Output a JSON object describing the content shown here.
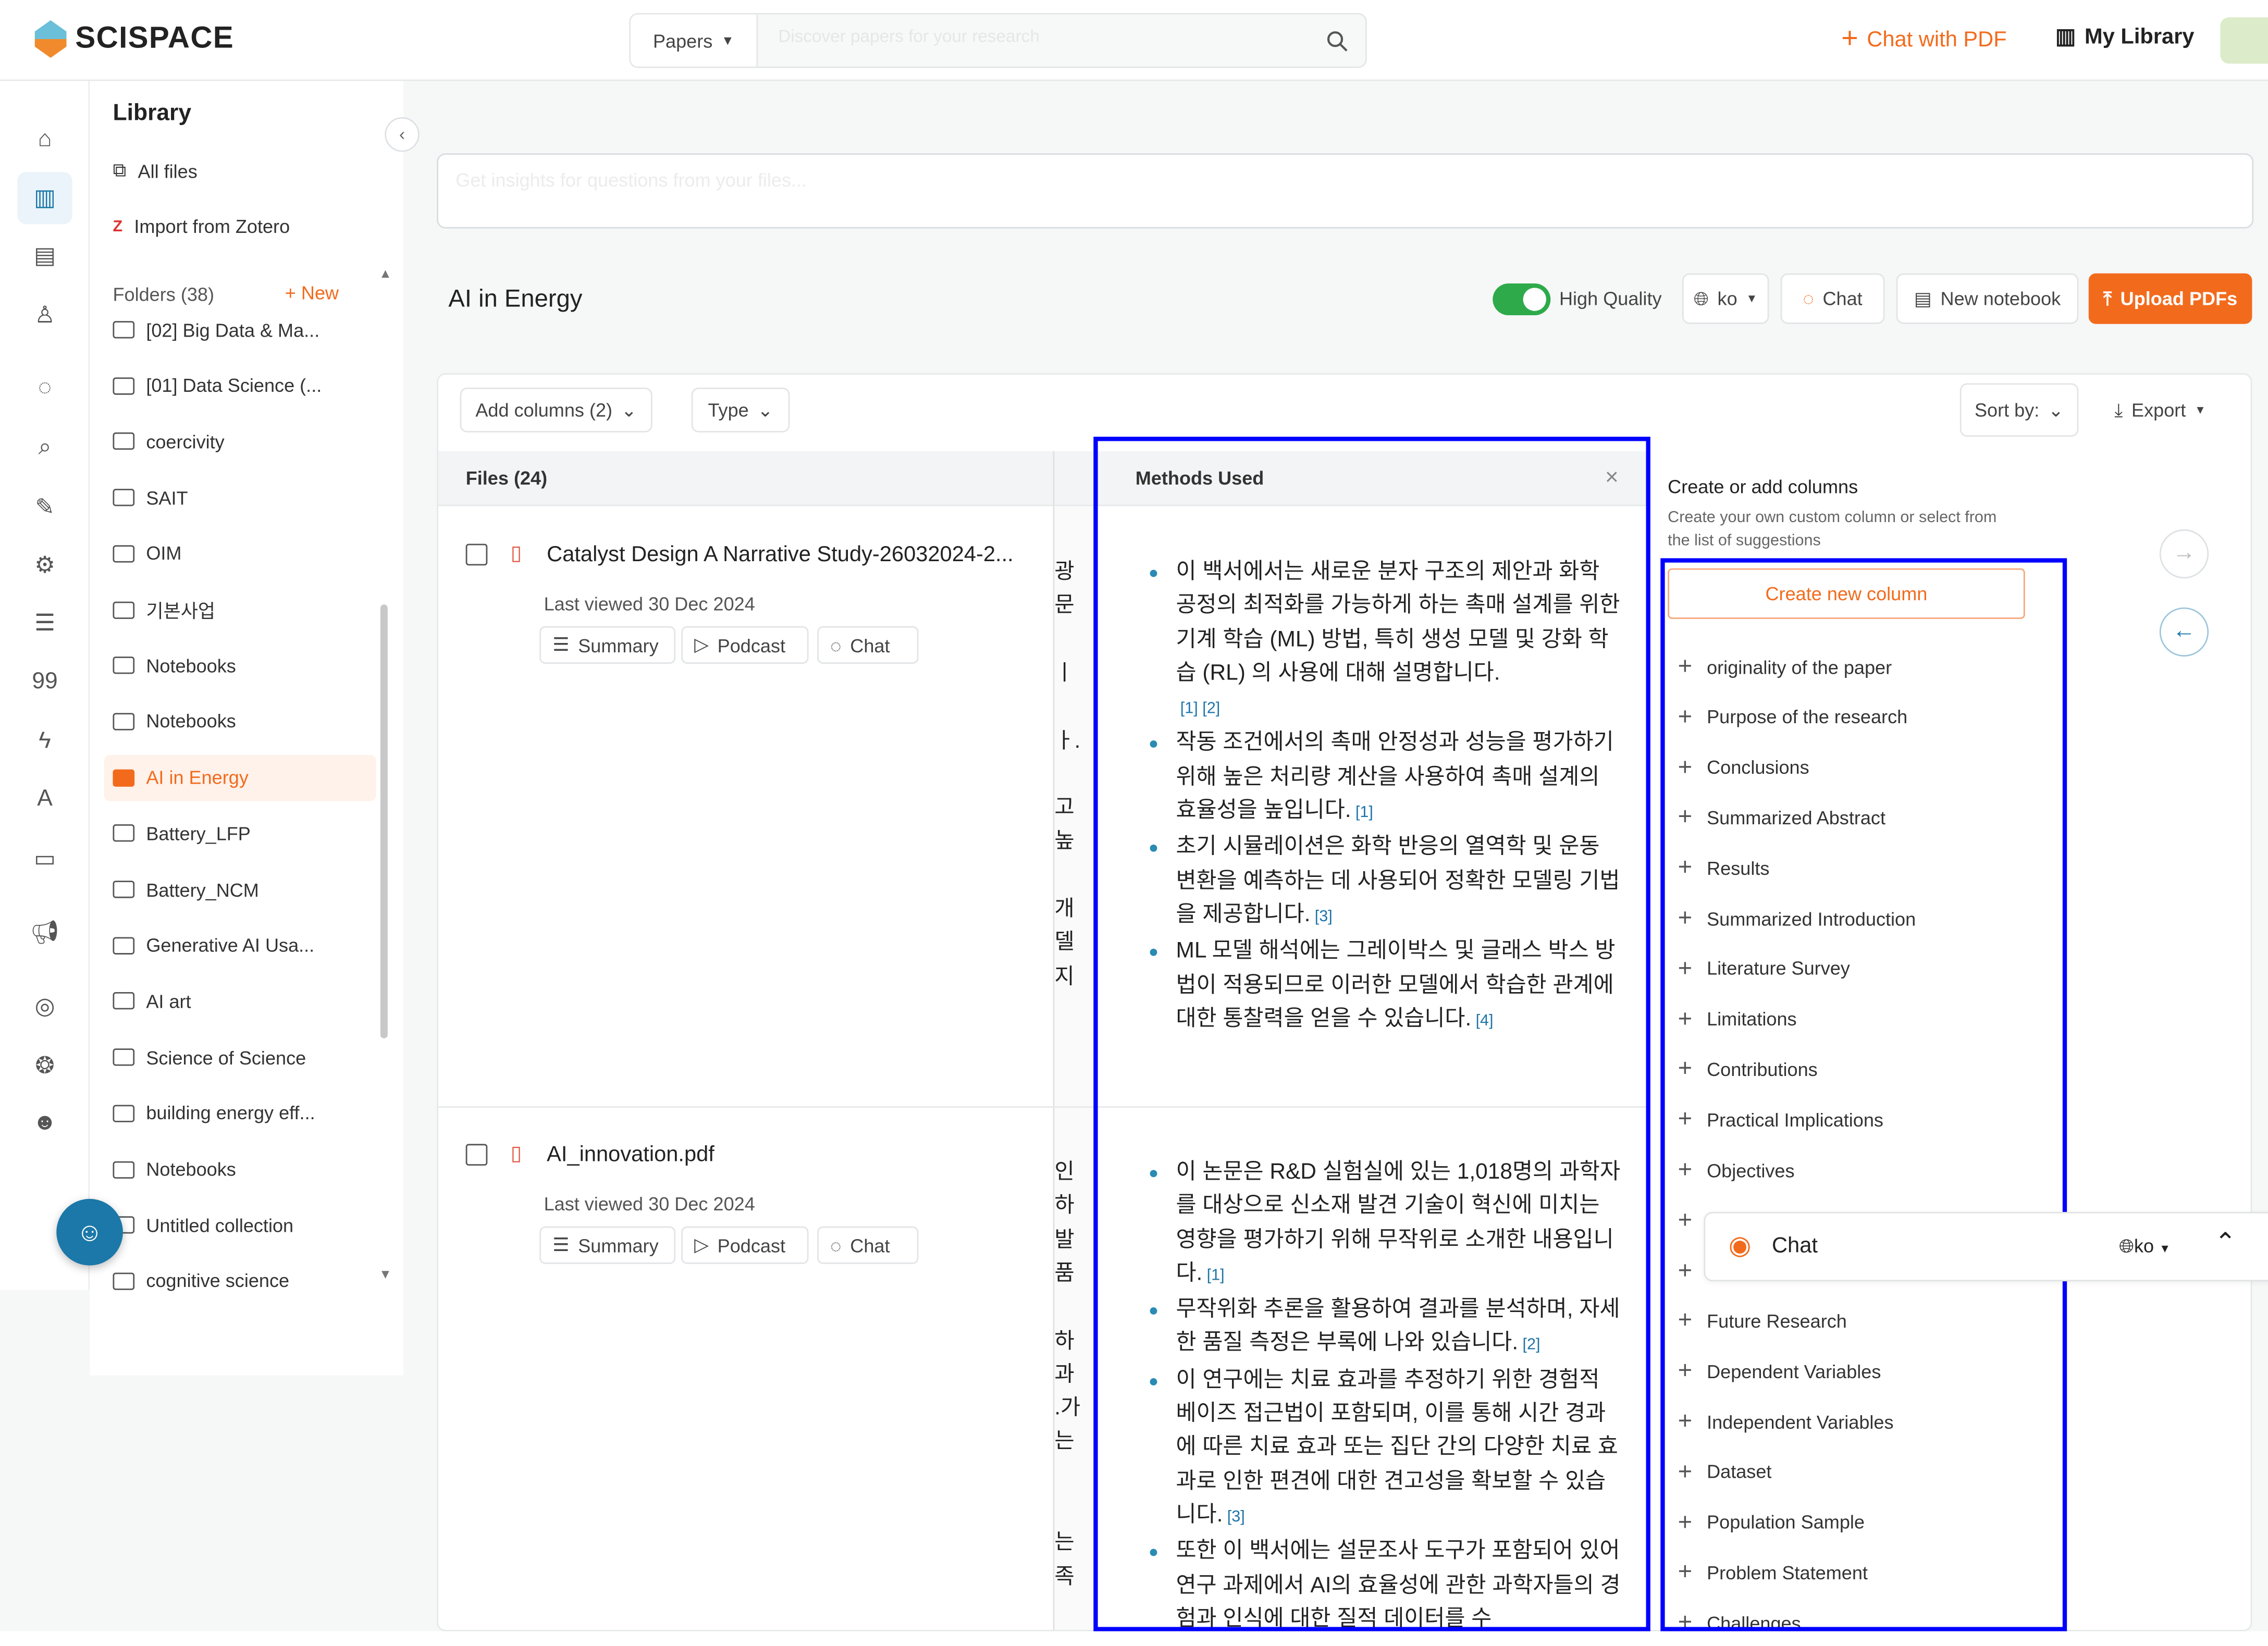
{
  "header": {
    "brand": "SCISPACE",
    "search_scope": "Papers",
    "search_placeholder": "Discover papers for your research",
    "chat_with_pdf": "Chat with PDF",
    "my_library": "My Library"
  },
  "rail": {
    "icons": [
      "home-icon",
      "library-icon",
      "notebook-icon",
      "user-icon",
      "chat-icon",
      "search-icon",
      "pen-icon",
      "integrations-icon",
      "list-icon",
      "quote-icon",
      "bolt-icon",
      "ai-icon",
      "video-icon",
      "megaphone-icon",
      "chrome-icon",
      "openai-icon",
      "discord-icon"
    ]
  },
  "library": {
    "title": "Library",
    "all_files": "All files",
    "import_zotero": "Import from Zotero",
    "folders_label": "Folders (38)",
    "new_label": "New",
    "folders": [
      "[02] Big Data & Ma...",
      "[01] Data Science (...",
      "coercivity",
      "SAIT",
      "OIM",
      "기본사업",
      "Notebooks",
      "Notebooks",
      "AI in Energy",
      "Battery_LFP",
      "Battery_NCM",
      "Generative AI Usa...",
      "AI art",
      "Science of Science",
      "building energy eff...",
      "Notebooks",
      "Untitled collection",
      "cognitive science"
    ],
    "active_folder": "AI in Energy"
  },
  "main": {
    "insights_placeholder": "Get insights for questions from your files...",
    "title": "AI in Energy",
    "high_quality": "High Quality",
    "high_quality_on": true,
    "language": "ko",
    "chat": "Chat",
    "new_notebook": "New notebook",
    "upload": "Upload PDFs"
  },
  "table": {
    "add_columns": "Add columns (2)",
    "type": "Type",
    "sort_by": "Sort by:",
    "export": "Export",
    "files_header": "Files (24)",
    "methods_header": "Methods Used",
    "rows": [
      {
        "name": "Catalyst Design A Narrative Study-26032024-2...",
        "last_viewed": "Last viewed 30 Dec 2024",
        "actions": [
          "Summary",
          "Podcast",
          "Chat"
        ],
        "hidden_col": [
          "광",
          "문",
          "",
          "ㅣ",
          "",
          "ㅏ.",
          "",
          "고",
          "높",
          "",
          "개",
          "델",
          "지"
        ],
        "methods": [
          {
            "text": "이 백서에서는 새로운 분자 구조의 제안과 화학 공정의 최적화를 가능하게 하는 촉매 설계를 위한 기계 학습 (ML) 방법, 특히 생성 모델 및 강화 학습 (RL) 의 사용에 대해 설명합니다.",
            "cite": "[1] [2]"
          },
          {
            "text": "작동 조건에서의 촉매 안정성과 성능을 평가하기 위해 높은 처리량 계산을 사용하여 촉매 설계의 효율성을 높입니다.",
            "cite": "[1]"
          },
          {
            "text": "초기 시뮬레이션은 화학 반응의 열역학 및 운동 변환을 예측하는 데 사용되어 정확한 모델링 기법을 제공합니다.",
            "cite": "[3]"
          },
          {
            "text": "ML 모델 해석에는 그레이박스 및 글래스 박스 방법이 적용되므로 이러한 모델에서 학습한 관계에 대한 통찰력을 얻을 수 있습니다.",
            "cite": "[4]"
          }
        ]
      },
      {
        "name": "AI_innovation.pdf",
        "last_viewed": "Last viewed 30 Dec 2024",
        "actions": [
          "Summary",
          "Podcast",
          "Chat"
        ],
        "hidden_col": [
          "인",
          "하",
          "발",
          "품",
          "",
          "하",
          "과",
          ".가",
          "는",
          "",
          "",
          "는",
          "족"
        ],
        "methods": [
          {
            "text": "이 논문은 R&D 실험실에 있는 1,018명의 과학자를 대상으로 신소재 발견 기술이 혁신에 미치는 영향을 평가하기 위해 무작위로 소개한 내용입니다.",
            "cite": "[1]"
          },
          {
            "text": "무작위화 추론을 활용하여 결과를 분석하며, 자세한 품질 측정은 부록에 나와 있습니다.",
            "cite": "[2]"
          },
          {
            "text": "이 연구에는 치료 효과를 추정하기 위한 경험적 베이즈 접근법이 포함되며, 이를 통해 시간 경과에 따른 치료 효과 또는 집단 간의 다양한 치료 효과로 인한 편견에 대한 견고성을 확보할 수 있습니다.",
            "cite": "[3]"
          },
          {
            "text": "또한 이 백서에는 설문조사 도구가 포함되어 있어 연구 과제에서 AI의 효율성에 관한 과학자들의 경험과 인식에 대한 질적 데이터를 수",
            "cite": ""
          }
        ]
      }
    ]
  },
  "columns_panel": {
    "title": "Create or add columns",
    "subtitle": "Create your own custom column or select from the list of suggestions",
    "create_new": "Create new column",
    "suggestions": [
      "originality of the paper",
      "Purpose of the research",
      "Conclusions",
      "Summarized Abstract",
      "Results",
      "Summarized Introduction",
      "Literature Survey",
      "Limitations",
      "Contributions",
      "Practical Implications",
      "Objectives",
      "",
      "",
      "Future Research",
      "Dependent Variables",
      "Independent Variables",
      "Dataset",
      "Population Sample",
      "Problem Statement",
      "Challenges"
    ]
  },
  "chat_bar": {
    "label": "Chat",
    "language": "ko"
  },
  "colors": {
    "accent": "#f26b1d",
    "highlight_border": "#0000ff",
    "citation": "#1f74a8",
    "toggle": "#2eaa4a"
  }
}
